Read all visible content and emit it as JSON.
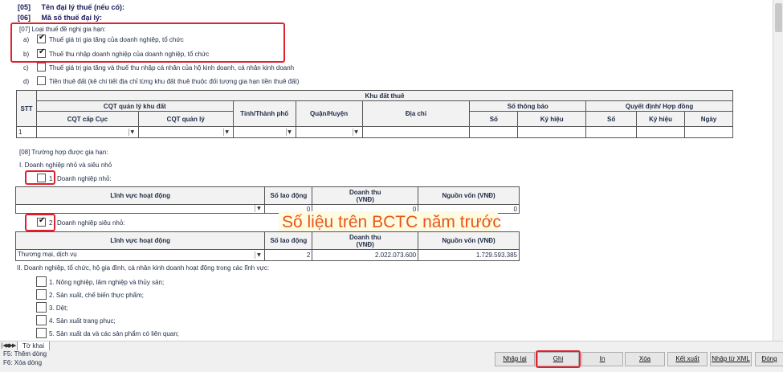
{
  "header": {
    "row05": {
      "code": "[05]",
      "label": "Tên đại lý thuế (nếu có):"
    },
    "row06": {
      "code": "[06]",
      "label": "Mã số thuế đại lý:"
    }
  },
  "section07": {
    "title": "[07]  Loại thuế đề nghị gia hạn:",
    "items": [
      {
        "letter": "a)",
        "label": "Thuế giá trị gia tăng của doanh nghiệp, tổ chức",
        "checked": true
      },
      {
        "letter": "b)",
        "label": "Thuế thu nhập doanh nghiệp của doanh nghiệp, tổ chức",
        "checked": true
      },
      {
        "letter": "c)",
        "label": "Thuế giá trị gia tăng và thuế thu nhập cá nhân của hộ kinh doanh, cá nhân kinh doanh",
        "checked": false
      },
      {
        "letter": "d)",
        "label": "Tiền thuê đất (kê chi tiết địa chỉ từng khu đất thuê thuộc đối tượng gia hạn tiền thuê đất)",
        "checked": false
      }
    ]
  },
  "land_table": {
    "stt": "STT",
    "group_title": "Khu đất thuê",
    "cqt_group": "CQT quản lý khu đất",
    "cqt_cap_cuc": "CQT cấp Cục",
    "cqt_quan_ly": "CQT quản lý",
    "tinh": "Tỉnh/Thành phố",
    "quan": "Quận/Huyện",
    "dia_chi": "Địa chỉ",
    "so_thong_bao": "Số thông báo",
    "quyet_dinh": "Quyết định/ Hợp đồng",
    "so": "Số",
    "ky_hieu": "Ký hiệu",
    "ngay": "Ngày",
    "row1_stt": "1"
  },
  "section08": {
    "title": "[08]  Trường hợp được gia hạn:",
    "group1": "I. Doanh nghiệp nhỏ và siêu nhỏ",
    "small": {
      "num": "1",
      "label": "Doanh nghiệp nhỏ:",
      "checked": false
    },
    "micro": {
      "num": "2",
      "label": "Doanh nghiệp siêu nhỏ:",
      "checked": true
    },
    "headers": {
      "linh_vuc": "Lĩnh vực hoạt động",
      "so_lao_dong": "Số lao động",
      "doanh_thu": "Doanh thu",
      "doanh_thu_unit": "(VNĐ)",
      "nguon_von": "Nguồn vốn (VNĐ)"
    },
    "small_row": {
      "linh_vuc": "",
      "so_lao_dong": "0",
      "doanh_thu": "0",
      "nguon_von": "0"
    },
    "micro_row": {
      "linh_vuc": "Thương mại, dịch vụ",
      "so_lao_dong": "2",
      "doanh_thu": "2.022.073.600",
      "nguon_von": "1.729.593.385"
    },
    "group2": "II. Doanh nghiệp, tổ chức, hộ gia đình, cá nhân kinh doanh hoạt động trong các lĩnh vực:",
    "sectors": [
      {
        "label": "1. Nông nghiệp, lâm nghiệp và thủy sản;",
        "checked": false
      },
      {
        "label": "2. Sản xuất, chế biến thực phẩm;",
        "checked": false
      },
      {
        "label": "3. Dệt;",
        "checked": false
      },
      {
        "label": "4. Sản xuất trang phục;",
        "checked": false
      },
      {
        "label": "5. Sản xuất da và các sản phẩm có liên quan;",
        "checked": false
      }
    ]
  },
  "annotation": "Số liệu trên BCTC năm trước",
  "tabs": {
    "active": "Tờ khai",
    "nav": [
      "|◀",
      "◀",
      "▶",
      "▶|"
    ]
  },
  "hints": [
    "F5: Thêm dòng",
    "F6: Xóa dòng"
  ],
  "buttons": {
    "nhap_lai": "Nhập lại",
    "ghi": "Ghi",
    "in": "In",
    "xoa": "Xóa",
    "ket_xuat": "Kết xuất",
    "nhap_xml": "Nhập từ XML",
    "dong": "Đóng"
  },
  "colors": {
    "highlight_box": "#e0202e",
    "annotation_text": "#e8561a"
  }
}
